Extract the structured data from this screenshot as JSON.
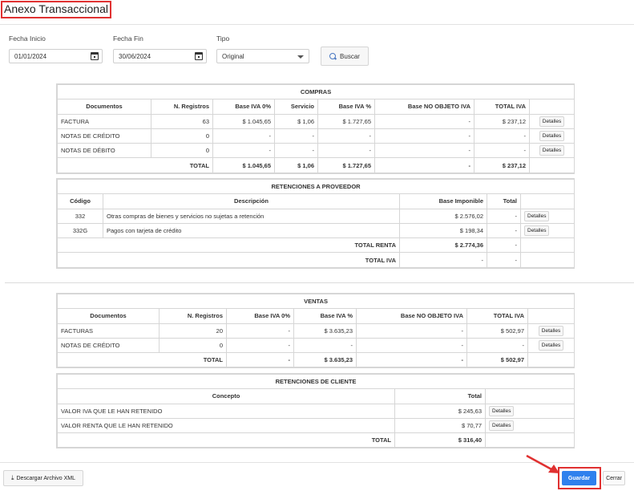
{
  "page": {
    "title": "Anexo Transaccional"
  },
  "filters": {
    "start_label": "Fecha Inicio",
    "start_value": "01/01/2024",
    "end_label": "Fecha Fin",
    "end_value": "30/06/2024",
    "type_label": "Tipo",
    "type_value": "Original",
    "search_label": "Buscar"
  },
  "compras": {
    "title": "COMPRAS",
    "headers": [
      "Documentos",
      "N. Registros",
      "Base IVA 0%",
      "Servicio",
      "Base IVA %",
      "Base NO OBJETO IVA",
      "TOTAL IVA"
    ],
    "rows": [
      [
        "FACTURA",
        "63",
        "$ 1.045,65",
        "$ 1,06",
        "$ 1.727,65",
        "-",
        "$ 237,12"
      ],
      [
        "NOTAS DE CRÉDITO",
        "0",
        "-",
        "-",
        "-",
        "-",
        "-"
      ],
      [
        "NOTAS DE DÉBITO",
        "0",
        "-",
        "-",
        "-",
        "-",
        "-"
      ]
    ],
    "total": [
      "TOTAL",
      "$ 1.045,65",
      "$ 1,06",
      "$ 1.727,65",
      "-",
      "$ 237,12"
    ]
  },
  "ret_proveedor": {
    "title": "RETENCIONES A PROVEEDOR",
    "headers": [
      "Código",
      "Descripción",
      "Base Imponible",
      "Total"
    ],
    "rows": [
      [
        "332",
        "Otras compras de bienes y servicios no sujetas a retención",
        "$ 2.576,02",
        "-"
      ],
      [
        "332G",
        "Pagos con tarjeta de crédito",
        "$ 198,34",
        "-"
      ]
    ],
    "total_renta_label": "TOTAL RENTA",
    "total_renta_base": "$ 2.774,36",
    "total_renta_total": "-",
    "total_iva_label": "TOTAL IVA",
    "total_iva_base": "-",
    "total_iva_total": "-"
  },
  "ventas": {
    "title": "VENTAS",
    "headers": [
      "Documentos",
      "N. Registros",
      "Base IVA 0%",
      "Base IVA %",
      "Base NO OBJETO IVA",
      "TOTAL IVA"
    ],
    "rows": [
      [
        "FACTURAS",
        "20",
        "-",
        "$ 3.635,23",
        "-",
        "$ 502,97"
      ],
      [
        "NOTAS DE CRÉDITO",
        "0",
        "-",
        "-",
        "-",
        "-"
      ]
    ],
    "total": [
      "TOTAL",
      "-",
      "$ 3.635,23",
      "-",
      "$ 502,97"
    ]
  },
  "ret_cliente": {
    "title": "RETENCIONES DE CLIENTE",
    "headers": [
      "Concepto",
      "Total"
    ],
    "rows": [
      [
        "VALOR IVA QUE LE HAN RETENIDO",
        "$ 245,63"
      ],
      [
        "VALOR RENTA QUE LE HAN RETENIDO",
        "$ 70,77"
      ]
    ],
    "total_label": "TOTAL",
    "total_value": "$ 316,40"
  },
  "details_label": "Detalles",
  "footer": {
    "xml_label": "Descargar Archivo XML",
    "save_label": "Guardar",
    "close_label": "Cerrar"
  },
  "colors": {
    "primary": "#2f80ed",
    "highlight": "#e03131"
  }
}
